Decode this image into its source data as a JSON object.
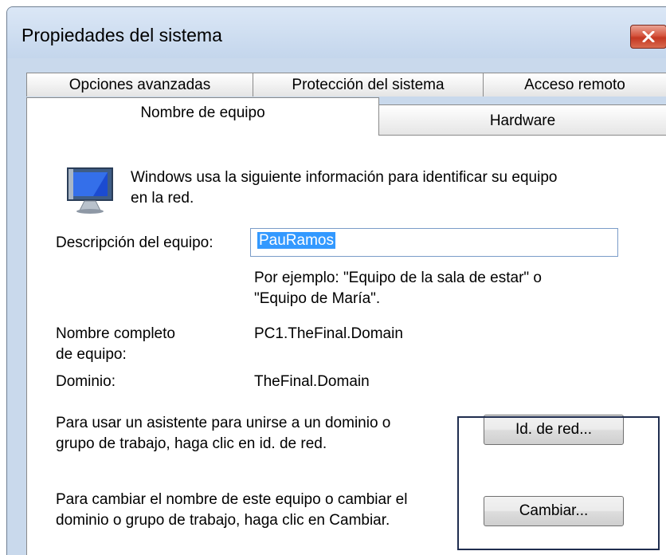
{
  "window": {
    "title": "Propiedades del sistema"
  },
  "tabs": {
    "top_row": [
      {
        "label": "Opciones avanzadas"
      },
      {
        "label": "Protección del sistema"
      },
      {
        "label": "Acceso remoto"
      }
    ],
    "bottom_row": [
      {
        "label": "Nombre de equipo",
        "selected": true
      },
      {
        "label": "Hardware"
      }
    ]
  },
  "panel": {
    "icon": "computer-monitor-icon",
    "intro_line1": "Windows usa la siguiente información para identificar su equipo",
    "intro_line2": "en la red.",
    "description_label": "Descripción del equipo:",
    "description_value": "PauRamos",
    "example_line1": "Por ejemplo: \"Equipo de la sala de estar\" o",
    "example_line2": "\"Equipo de María\".",
    "fullname_label_line1": "Nombre completo",
    "fullname_label_line2": "de equipo:",
    "fullname_value": "PC1.TheFinal.Domain",
    "domain_label": "Dominio:",
    "domain_value": "TheFinal.Domain",
    "network_text_line1": "Para usar un asistente para unirse a un dominio o",
    "network_text_line2": "grupo de trabajo, haga clic en id. de red.",
    "network_button": "Id. de red...",
    "change_text_line1": "Para cambiar el nombre de este equipo o cambiar el",
    "change_text_line2": "dominio o grupo de trabajo, haga clic en Cambiar.",
    "change_button": "Cambiar..."
  },
  "colors": {
    "title_bg": "#c9d9ec",
    "close_button": "#c43822",
    "selection": "#3399ff",
    "focus_rect": "#1f2d4f"
  }
}
